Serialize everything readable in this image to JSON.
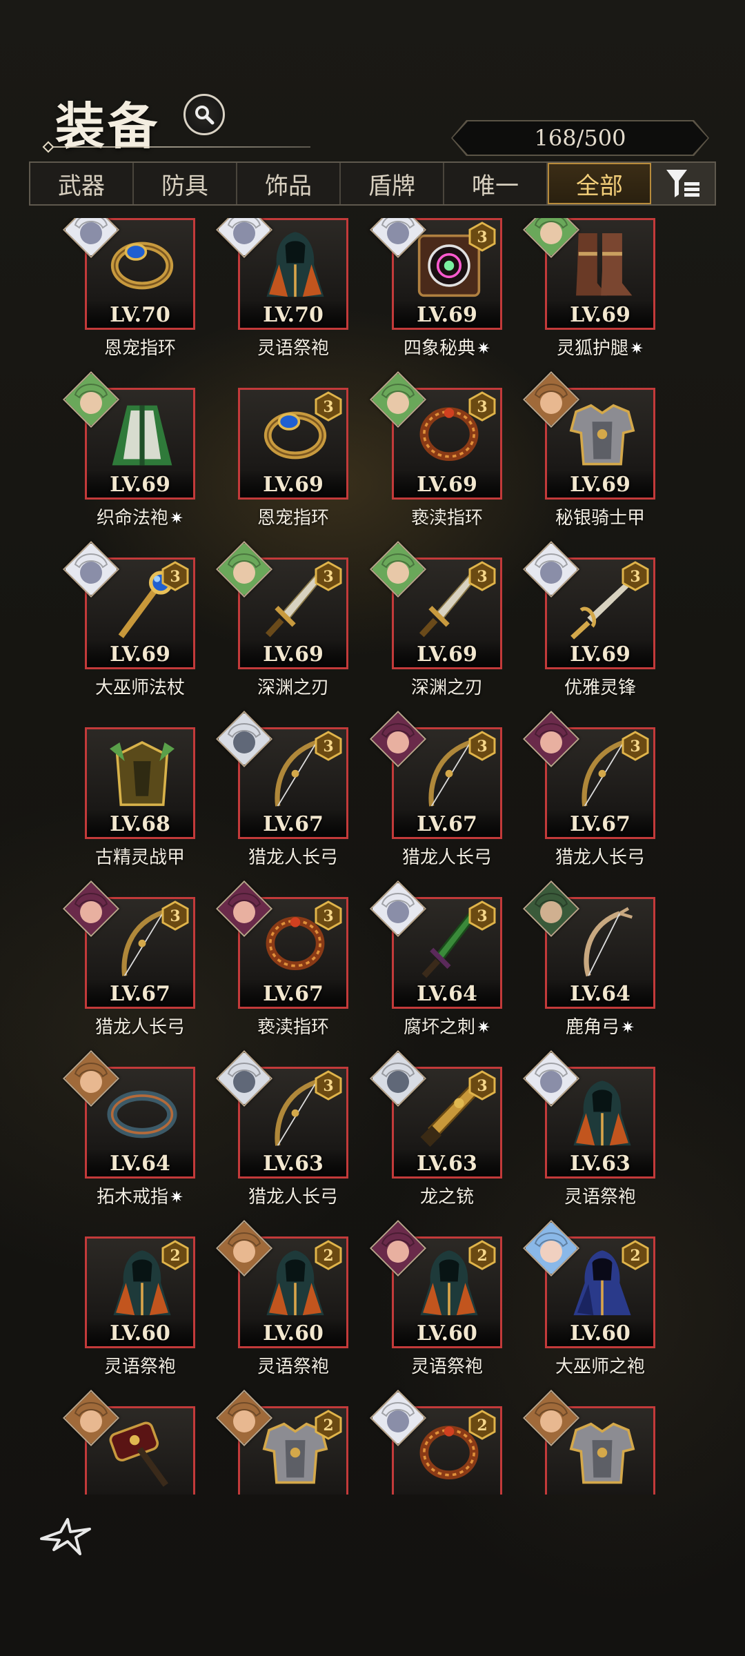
{
  "header": {
    "title": "装备",
    "count": "168/500"
  },
  "tabs": [
    {
      "label": "武器",
      "active": false
    },
    {
      "label": "防具",
      "active": false
    },
    {
      "label": "饰品",
      "active": false
    },
    {
      "label": "盾牌",
      "active": false
    },
    {
      "label": "唯一",
      "active": false
    },
    {
      "label": "全部",
      "active": true
    }
  ],
  "items": [
    {
      "level": "LV.70",
      "name": "恩宠指环",
      "tier": "",
      "spark": false,
      "icon": "ring-blue-gem-icon",
      "portrait": "white-cat"
    },
    {
      "level": "LV.70",
      "name": "灵语祭袍",
      "tier": "",
      "spark": false,
      "icon": "hooded-robe-icon",
      "portrait": "white-cat"
    },
    {
      "level": "LV.69",
      "name": "四象秘典",
      "tier": "3",
      "spark": true,
      "icon": "tome-icon",
      "portrait": "white-cat"
    },
    {
      "level": "LV.69",
      "name": "灵狐护腿",
      "tier": "",
      "spark": true,
      "icon": "boots-icon",
      "portrait": "green-elf"
    },
    {
      "level": "LV.69",
      "name": "织命法袍",
      "tier": "",
      "spark": true,
      "icon": "green-robe-icon",
      "portrait": "green-elf"
    },
    {
      "level": "LV.69",
      "name": "恩宠指环",
      "tier": "3",
      "spark": false,
      "icon": "ring-blue-gem-icon",
      "portrait": ""
    },
    {
      "level": "LV.69",
      "name": "亵渎指环",
      "tier": "3",
      "spark": false,
      "icon": "ring-red-icon",
      "portrait": "green-elf"
    },
    {
      "level": "LV.69",
      "name": "秘银骑士甲",
      "tier": "",
      "spark": false,
      "icon": "plate-armor-icon",
      "portrait": "brown-warrior"
    },
    {
      "level": "LV.69",
      "name": "大巫师法杖",
      "tier": "3",
      "spark": false,
      "icon": "staff-icon",
      "portrait": "white-cat"
    },
    {
      "level": "LV.69",
      "name": "深渊之刃",
      "tier": "3",
      "spark": false,
      "icon": "dagger-icon",
      "portrait": "green-elf"
    },
    {
      "level": "LV.69",
      "name": "深渊之刃",
      "tier": "3",
      "spark": false,
      "icon": "dagger-icon",
      "portrait": "green-elf"
    },
    {
      "level": "LV.69",
      "name": "优雅灵锋",
      "tier": "3",
      "spark": false,
      "icon": "sword-icon",
      "portrait": "white-cat"
    },
    {
      "level": "LV.68",
      "name": "古精灵战甲",
      "tier": "",
      "spark": false,
      "icon": "elven-armor-icon",
      "portrait": ""
    },
    {
      "level": "LV.67",
      "name": "猎龙人长弓",
      "tier": "3",
      "spark": false,
      "icon": "longbow-icon",
      "portrait": "white-dragon"
    },
    {
      "level": "LV.67",
      "name": "猎龙人长弓",
      "tier": "3",
      "spark": false,
      "icon": "longbow-icon",
      "portrait": "purple-hood"
    },
    {
      "level": "LV.67",
      "name": "猎龙人长弓",
      "tier": "3",
      "spark": false,
      "icon": "longbow-icon",
      "portrait": "purple-hood"
    },
    {
      "level": "LV.67",
      "name": "猎龙人长弓",
      "tier": "3",
      "spark": false,
      "icon": "longbow-icon",
      "portrait": "purple-hood"
    },
    {
      "level": "LV.67",
      "name": "亵渎指环",
      "tier": "3",
      "spark": false,
      "icon": "ring-red-icon",
      "portrait": "purple-hood"
    },
    {
      "level": "LV.64",
      "name": "腐坏之刺",
      "tier": "3",
      "spark": true,
      "icon": "thorn-dagger-icon",
      "portrait": "white-cat"
    },
    {
      "level": "LV.64",
      "name": "鹿角弓",
      "tier": "",
      "spark": true,
      "icon": "antler-bow-icon",
      "portrait": "green-hood"
    },
    {
      "level": "LV.64",
      "name": "拓木戒指",
      "tier": "",
      "spark": true,
      "icon": "wood-ring-icon",
      "portrait": "brown-warrior"
    },
    {
      "level": "LV.63",
      "name": "猎龙人长弓",
      "tier": "3",
      "spark": false,
      "icon": "longbow-icon",
      "portrait": "white-dragon"
    },
    {
      "level": "LV.63",
      "name": "龙之铳",
      "tier": "3",
      "spark": false,
      "icon": "dragon-gun-icon",
      "portrait": "white-dragon"
    },
    {
      "level": "LV.63",
      "name": "灵语祭袍",
      "tier": "",
      "spark": false,
      "icon": "hooded-robe-icon",
      "portrait": "white-cat"
    },
    {
      "level": "LV.60",
      "name": "灵语祭袍",
      "tier": "2",
      "spark": false,
      "icon": "hooded-robe-icon",
      "portrait": ""
    },
    {
      "level": "LV.60",
      "name": "灵语祭袍",
      "tier": "2",
      "spark": false,
      "icon": "hooded-robe-icon",
      "portrait": "brown-warrior"
    },
    {
      "level": "LV.60",
      "name": "灵语祭袍",
      "tier": "2",
      "spark": false,
      "icon": "hooded-robe-icon",
      "portrait": "purple-hood"
    },
    {
      "level": "LV.60",
      "name": "大巫师之袍",
      "tier": "2",
      "spark": false,
      "icon": "blue-robe-icon",
      "portrait": "blue-hair"
    },
    {
      "level": "",
      "name": "",
      "tier": "",
      "spark": false,
      "icon": "hammer-icon",
      "portrait": "brown-warrior"
    },
    {
      "level": "",
      "name": "",
      "tier": "2",
      "spark": false,
      "icon": "plate-armor-icon",
      "portrait": "brown-warrior"
    },
    {
      "level": "",
      "name": "",
      "tier": "2",
      "spark": false,
      "icon": "ring-red-icon",
      "portrait": "white-cat"
    },
    {
      "level": "",
      "name": "",
      "tier": "",
      "spark": false,
      "icon": "plate-armor-icon",
      "portrait": "brown-warrior"
    }
  ],
  "colors": {
    "frame_border": "#c33a3a",
    "tier_gold": "#c9962e",
    "active_tab": "#f3cf7a"
  }
}
